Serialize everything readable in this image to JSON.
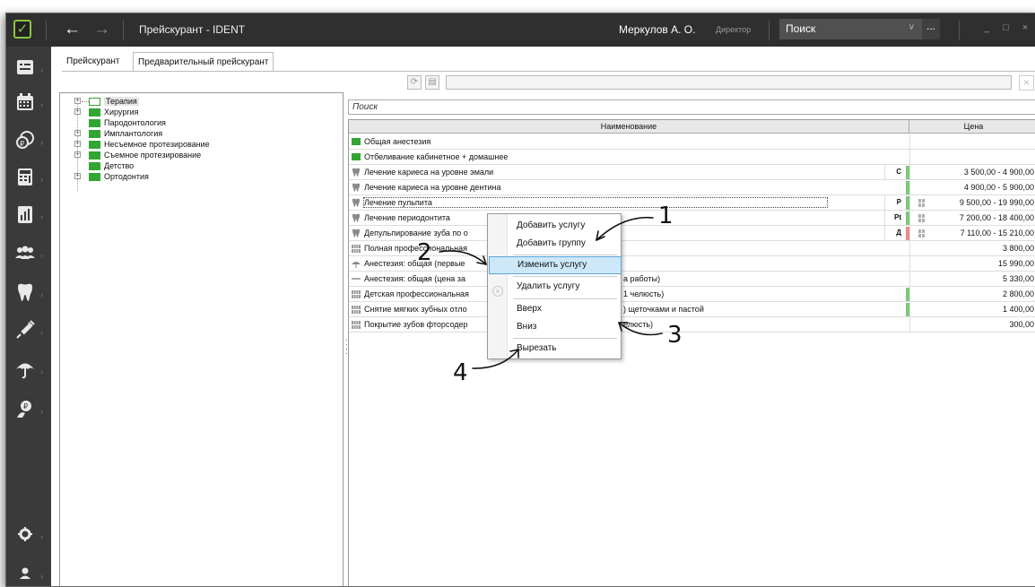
{
  "titlebar": {
    "app_title": "Прейскурант - IDENT",
    "user_name": "Меркулов А. О.",
    "user_role": "Директор",
    "search_placeholder": "Поиск",
    "search_more": "...",
    "win_controls": "_ □ ×"
  },
  "sidebar": {
    "items": [
      {
        "icon": "document-list-icon"
      },
      {
        "icon": "calendar-icon"
      },
      {
        "icon": "payments-icon"
      },
      {
        "icon": "calculator-icon"
      },
      {
        "icon": "reports-icon"
      },
      {
        "icon": "patients-icon"
      },
      {
        "icon": "tooth-icon"
      },
      {
        "icon": "syringe-icon"
      },
      {
        "icon": "insurance-umbrella-icon"
      },
      {
        "icon": "doctor-icon"
      },
      {
        "icon": "settings-icon"
      },
      {
        "icon": "user-icon"
      }
    ]
  },
  "tabs": [
    "Прейскурант",
    "Предварительный прейскурант"
  ],
  "tree": {
    "items": [
      {
        "label": "Терапия",
        "expandable": true,
        "selected": true
      },
      {
        "label": "Хирургия",
        "expandable": true
      },
      {
        "label": "Пародонтология",
        "expandable": false
      },
      {
        "label": "Имплантология",
        "expandable": true
      },
      {
        "label": "Несъемное протезирование",
        "expandable": true
      },
      {
        "label": "Съемное протезирование",
        "expandable": true
      },
      {
        "label": "Детство",
        "expandable": false
      },
      {
        "label": "Ортодонтия",
        "expandable": true
      }
    ]
  },
  "grid": {
    "search_placeholder": "Поиск",
    "header": {
      "name": "Наименование",
      "price": "Цена"
    },
    "rows": [
      {
        "icon": "folder",
        "name": "Общая анестезия",
        "code": "",
        "bar": "",
        "price": ""
      },
      {
        "icon": "folder",
        "name": "Отбеливание кабинетное + домашнее",
        "code": "",
        "bar": "",
        "price": ""
      },
      {
        "icon": "tooth",
        "name": "Лечение кариеса на уровне эмали",
        "code": "С",
        "bar": "#7cc97c",
        "price": "3 500,00 - 4 900,00"
      },
      {
        "icon": "tooth",
        "name": "Лечение  кариеса на уровне дентина",
        "code": "",
        "bar": "#7cc97c",
        "price": "4 900,00 - 5 900,00"
      },
      {
        "icon": "tooth",
        "name": "Лечение пульпита",
        "code": "Р",
        "bar": "#7cc97c",
        "price": "9 500,00 - 19 990,00"
      },
      {
        "icon": "tooth",
        "name": "Лечение периодонтита",
        "code": "Pt",
        "bar": "#7cc97c",
        "price": "7 200,00 - 18 400,00"
      },
      {
        "icon": "tooth",
        "name": "Депульпирование зуба по о",
        "code": "Д",
        "bar": "#e88a8a",
        "price": "7 110,00 - 15 210,00"
      },
      {
        "icon": "jaw",
        "name": "Полная профессиональная",
        "code": "",
        "bar": "",
        "price": "3 800,00"
      },
      {
        "icon": "umbrella",
        "name": "Анестезия: общая (первые",
        "code": "",
        "bar": "",
        "price": "15 990,00"
      },
      {
        "icon": "line",
        "name": "Анестезия: общая (цена за",
        "name_tail": "а работы)",
        "code": "",
        "bar": "",
        "price": "5 330,00"
      },
      {
        "icon": "jaw",
        "name": "Детская профессиональная",
        "name_tail": "1 челюсть)",
        "code": "",
        "bar": "#7cc97c",
        "price": "2 800,00"
      },
      {
        "icon": "jaw",
        "name": "Снятие мягких зубных отло",
        "name_tail": ") щеточками и пастой",
        "code": "",
        "bar": "#7cc97c",
        "price": "1 400,00"
      },
      {
        "icon": "jaw",
        "name": "Покрытие зубов фторсодер",
        "name_tail": "елюсть)",
        "code": "",
        "bar": "",
        "price": "300,00"
      }
    ]
  },
  "context_menu": {
    "items": [
      "Добавить услугу",
      "Добавить группу",
      "Изменить услугу",
      "Удалить услугу",
      "Вверх",
      "Вниз",
      "Вырезать"
    ]
  },
  "annotations": [
    "1",
    "2",
    "3",
    "4"
  ],
  "colors": {
    "accent_green": "#33a532",
    "titlebar": "#2f2f2f",
    "sidebar": "#3a3a3a",
    "highlight": "#cde8f9"
  }
}
